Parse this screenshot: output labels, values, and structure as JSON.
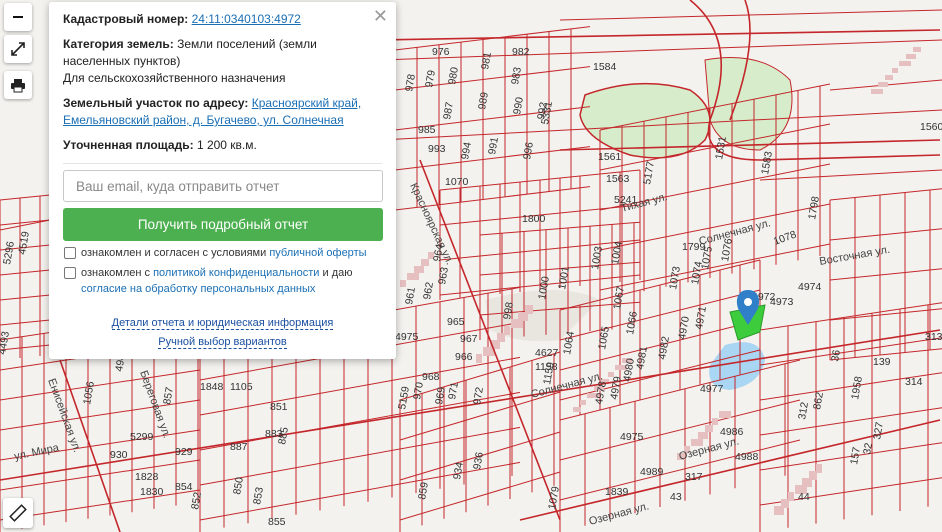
{
  "popup": {
    "cadastral_label": "Кадастровый номер:",
    "cadastral_number": "24:11:0340103:4972",
    "category_label": "Категория земель:",
    "category_value": "Земли поселений (земли населенных пунктов)",
    "category_sub": "Для сельскохозяйственного назначения",
    "address_label": "Земельный участок по адресу:",
    "address_value": "Красноярский край, Емельяновский район, д. Бугачево, ул. Солнечная",
    "area_label": "Уточненная площадь:",
    "area_value": "1 200 кв.м.",
    "email_placeholder": "Ваш email, куда отправить отчет",
    "submit_label": "Получить подробный отчет",
    "check1_text": "ознакомлен и согласен с условиями",
    "check1_link": "публичной оферты",
    "check2_text": "ознакомлен с",
    "check2_link1": "политикой конфиденциальности",
    "check2_mid": "и даю",
    "check2_link2": "согласие на обработку персональных данных",
    "details_link": "Детали отчета и юридическая информация",
    "manual_link": "Ручной выбор вариантов"
  },
  "map": {
    "streets": [
      "Красноярская ул.",
      "Тихая ул.",
      "Солнечная ул.",
      "Солнечная ул.",
      "Енисейская ул.",
      "ул. Мира",
      "Озерная ул.",
      "Озерная ул.",
      "Береговая ул.",
      "Восточная ул."
    ],
    "parcel_labels": [
      "976",
      "982",
      "978",
      "979",
      "980",
      "981",
      "983",
      "985",
      "987",
      "989",
      "990",
      "992",
      "993",
      "994",
      "991",
      "996",
      "1070",
      "5331",
      "1584",
      "1560",
      "1561",
      "1563",
      "5241",
      "5177",
      "1531",
      "1583",
      "1800",
      "1799",
      "1798",
      "1078",
      "1076",
      "1075",
      "1073",
      "1074",
      "1003",
      "1004",
      "1066",
      "1067",
      "1065",
      "1064",
      "1000",
      "1001",
      "998",
      "963",
      "962",
      "961",
      "965",
      "967",
      "966",
      "964",
      "968",
      "969",
      "970",
      "971",
      "972",
      "4627",
      "1158",
      "1159",
      "4974",
      "4973",
      "4972",
      "4971",
      "4970",
      "4982",
      "4981",
      "4980",
      "4979",
      "4978",
      "4977",
      "4975",
      "4975",
      "5159",
      "5296",
      "4519",
      "4493",
      "4943",
      "1056",
      "1848",
      "1105",
      "851",
      "883",
      "885",
      "887",
      "930",
      "5299",
      "929",
      "1828",
      "1830",
      "854",
      "852",
      "850",
      "853",
      "855",
      "857",
      "859",
      "934",
      "936",
      "1079",
      "1839",
      "4986",
      "4988",
      "4989",
      "317",
      "43",
      "44",
      "327",
      "32",
      "157",
      "36",
      "139",
      "314",
      "313",
      "312",
      "1958",
      "862",
      "316",
      "514",
      "356",
      "364",
      "305",
      "4994"
    ],
    "selected_parcel": "4972",
    "marker_color": "#2f7fc9",
    "highlight_color": "#3ccc3c",
    "line_color": "#c4272b",
    "green_area_color": "#d6ecca",
    "water_color": "#a9d6f2"
  },
  "controls": {
    "zoom_out_icon": "minus-icon",
    "fullscreen_icon": "expand-icon",
    "print_icon": "printer-icon",
    "ruler_icon": "ruler-icon"
  }
}
